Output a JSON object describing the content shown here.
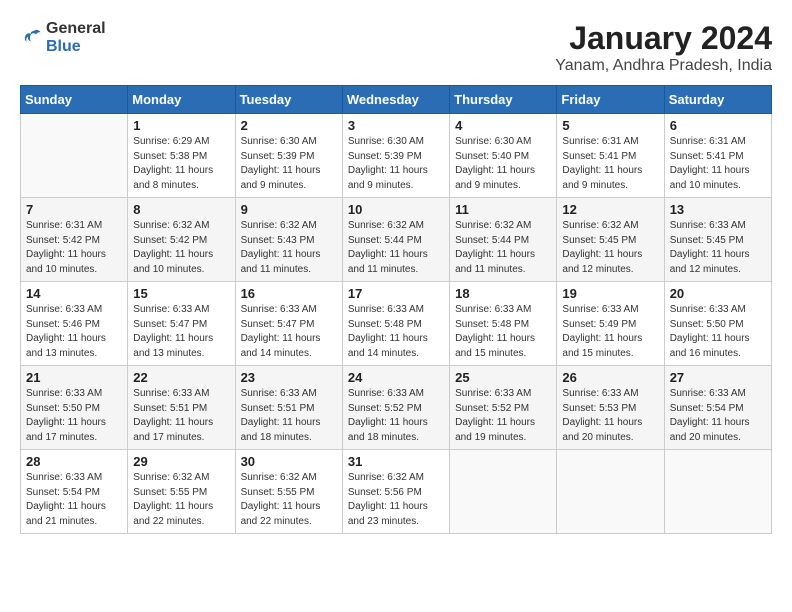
{
  "header": {
    "logo_general": "General",
    "logo_blue": "Blue",
    "month": "January 2024",
    "location": "Yanam, Andhra Pradesh, India"
  },
  "days_of_week": [
    "Sunday",
    "Monday",
    "Tuesday",
    "Wednesday",
    "Thursday",
    "Friday",
    "Saturday"
  ],
  "weeks": [
    [
      {
        "num": "",
        "sunrise": "",
        "sunset": "",
        "daylight": ""
      },
      {
        "num": "1",
        "sunrise": "Sunrise: 6:29 AM",
        "sunset": "Sunset: 5:38 PM",
        "daylight": "Daylight: 11 hours and 8 minutes."
      },
      {
        "num": "2",
        "sunrise": "Sunrise: 6:30 AM",
        "sunset": "Sunset: 5:39 PM",
        "daylight": "Daylight: 11 hours and 9 minutes."
      },
      {
        "num": "3",
        "sunrise": "Sunrise: 6:30 AM",
        "sunset": "Sunset: 5:39 PM",
        "daylight": "Daylight: 11 hours and 9 minutes."
      },
      {
        "num": "4",
        "sunrise": "Sunrise: 6:30 AM",
        "sunset": "Sunset: 5:40 PM",
        "daylight": "Daylight: 11 hours and 9 minutes."
      },
      {
        "num": "5",
        "sunrise": "Sunrise: 6:31 AM",
        "sunset": "Sunset: 5:41 PM",
        "daylight": "Daylight: 11 hours and 9 minutes."
      },
      {
        "num": "6",
        "sunrise": "Sunrise: 6:31 AM",
        "sunset": "Sunset: 5:41 PM",
        "daylight": "Daylight: 11 hours and 10 minutes."
      }
    ],
    [
      {
        "num": "7",
        "sunrise": "Sunrise: 6:31 AM",
        "sunset": "Sunset: 5:42 PM",
        "daylight": "Daylight: 11 hours and 10 minutes."
      },
      {
        "num": "8",
        "sunrise": "Sunrise: 6:32 AM",
        "sunset": "Sunset: 5:42 PM",
        "daylight": "Daylight: 11 hours and 10 minutes."
      },
      {
        "num": "9",
        "sunrise": "Sunrise: 6:32 AM",
        "sunset": "Sunset: 5:43 PM",
        "daylight": "Daylight: 11 hours and 11 minutes."
      },
      {
        "num": "10",
        "sunrise": "Sunrise: 6:32 AM",
        "sunset": "Sunset: 5:44 PM",
        "daylight": "Daylight: 11 hours and 11 minutes."
      },
      {
        "num": "11",
        "sunrise": "Sunrise: 6:32 AM",
        "sunset": "Sunset: 5:44 PM",
        "daylight": "Daylight: 11 hours and 11 minutes."
      },
      {
        "num": "12",
        "sunrise": "Sunrise: 6:32 AM",
        "sunset": "Sunset: 5:45 PM",
        "daylight": "Daylight: 11 hours and 12 minutes."
      },
      {
        "num": "13",
        "sunrise": "Sunrise: 6:33 AM",
        "sunset": "Sunset: 5:45 PM",
        "daylight": "Daylight: 11 hours and 12 minutes."
      }
    ],
    [
      {
        "num": "14",
        "sunrise": "Sunrise: 6:33 AM",
        "sunset": "Sunset: 5:46 PM",
        "daylight": "Daylight: 11 hours and 13 minutes."
      },
      {
        "num": "15",
        "sunrise": "Sunrise: 6:33 AM",
        "sunset": "Sunset: 5:47 PM",
        "daylight": "Daylight: 11 hours and 13 minutes."
      },
      {
        "num": "16",
        "sunrise": "Sunrise: 6:33 AM",
        "sunset": "Sunset: 5:47 PM",
        "daylight": "Daylight: 11 hours and 14 minutes."
      },
      {
        "num": "17",
        "sunrise": "Sunrise: 6:33 AM",
        "sunset": "Sunset: 5:48 PM",
        "daylight": "Daylight: 11 hours and 14 minutes."
      },
      {
        "num": "18",
        "sunrise": "Sunrise: 6:33 AM",
        "sunset": "Sunset: 5:48 PM",
        "daylight": "Daylight: 11 hours and 15 minutes."
      },
      {
        "num": "19",
        "sunrise": "Sunrise: 6:33 AM",
        "sunset": "Sunset: 5:49 PM",
        "daylight": "Daylight: 11 hours and 15 minutes."
      },
      {
        "num": "20",
        "sunrise": "Sunrise: 6:33 AM",
        "sunset": "Sunset: 5:50 PM",
        "daylight": "Daylight: 11 hours and 16 minutes."
      }
    ],
    [
      {
        "num": "21",
        "sunrise": "Sunrise: 6:33 AM",
        "sunset": "Sunset: 5:50 PM",
        "daylight": "Daylight: 11 hours and 17 minutes."
      },
      {
        "num": "22",
        "sunrise": "Sunrise: 6:33 AM",
        "sunset": "Sunset: 5:51 PM",
        "daylight": "Daylight: 11 hours and 17 minutes."
      },
      {
        "num": "23",
        "sunrise": "Sunrise: 6:33 AM",
        "sunset": "Sunset: 5:51 PM",
        "daylight": "Daylight: 11 hours and 18 minutes."
      },
      {
        "num": "24",
        "sunrise": "Sunrise: 6:33 AM",
        "sunset": "Sunset: 5:52 PM",
        "daylight": "Daylight: 11 hours and 18 minutes."
      },
      {
        "num": "25",
        "sunrise": "Sunrise: 6:33 AM",
        "sunset": "Sunset: 5:52 PM",
        "daylight": "Daylight: 11 hours and 19 minutes."
      },
      {
        "num": "26",
        "sunrise": "Sunrise: 6:33 AM",
        "sunset": "Sunset: 5:53 PM",
        "daylight": "Daylight: 11 hours and 20 minutes."
      },
      {
        "num": "27",
        "sunrise": "Sunrise: 6:33 AM",
        "sunset": "Sunset: 5:54 PM",
        "daylight": "Daylight: 11 hours and 20 minutes."
      }
    ],
    [
      {
        "num": "28",
        "sunrise": "Sunrise: 6:33 AM",
        "sunset": "Sunset: 5:54 PM",
        "daylight": "Daylight: 11 hours and 21 minutes."
      },
      {
        "num": "29",
        "sunrise": "Sunrise: 6:32 AM",
        "sunset": "Sunset: 5:55 PM",
        "daylight": "Daylight: 11 hours and 22 minutes."
      },
      {
        "num": "30",
        "sunrise": "Sunrise: 6:32 AM",
        "sunset": "Sunset: 5:55 PM",
        "daylight": "Daylight: 11 hours and 22 minutes."
      },
      {
        "num": "31",
        "sunrise": "Sunrise: 6:32 AM",
        "sunset": "Sunset: 5:56 PM",
        "daylight": "Daylight: 11 hours and 23 minutes."
      },
      {
        "num": "",
        "sunrise": "",
        "sunset": "",
        "daylight": ""
      },
      {
        "num": "",
        "sunrise": "",
        "sunset": "",
        "daylight": ""
      },
      {
        "num": "",
        "sunrise": "",
        "sunset": "",
        "daylight": ""
      }
    ]
  ]
}
